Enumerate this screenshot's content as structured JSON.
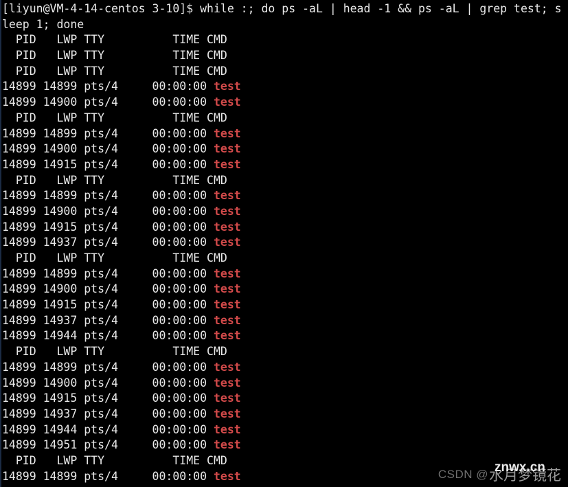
{
  "terminal": {
    "background_color": "#000000",
    "foreground_color": "#e8e8e8",
    "accent_red": "#d24a4a",
    "prompt": "[liyun@VM-4-14-centos 3-10]$ ",
    "command": "while :; do ps -aL | head -1 && ps -aL | grep test; sleep 1; done",
    "header_text": "  PID   LWP TTY          TIME CMD",
    "lines": [
      {
        "type": "command",
        "text": "[liyun@VM-4-14-centos 3-10]$ while :; do ps -aL | head -1 && ps -aL | grep test; s"
      },
      {
        "type": "command",
        "text": "leep 1; done"
      },
      {
        "type": "header",
        "text": "  PID   LWP TTY          TIME CMD"
      },
      {
        "type": "header",
        "text": "  PID   LWP TTY          TIME CMD"
      },
      {
        "type": "header",
        "text": "  PID   LWP TTY          TIME CMD"
      },
      {
        "type": "process",
        "pid": "14899",
        "lwp": "14899",
        "tty": "pts/4",
        "time": "00:00:00",
        "cmd": "test"
      },
      {
        "type": "process",
        "pid": "14899",
        "lwp": "14900",
        "tty": "pts/4",
        "time": "00:00:00",
        "cmd": "test"
      },
      {
        "type": "header",
        "text": "  PID   LWP TTY          TIME CMD"
      },
      {
        "type": "process",
        "pid": "14899",
        "lwp": "14899",
        "tty": "pts/4",
        "time": "00:00:00",
        "cmd": "test"
      },
      {
        "type": "process",
        "pid": "14899",
        "lwp": "14900",
        "tty": "pts/4",
        "time": "00:00:00",
        "cmd": "test"
      },
      {
        "type": "process",
        "pid": "14899",
        "lwp": "14915",
        "tty": "pts/4",
        "time": "00:00:00",
        "cmd": "test"
      },
      {
        "type": "header",
        "text": "  PID   LWP TTY          TIME CMD"
      },
      {
        "type": "process",
        "pid": "14899",
        "lwp": "14899",
        "tty": "pts/4",
        "time": "00:00:00",
        "cmd": "test"
      },
      {
        "type": "process",
        "pid": "14899",
        "lwp": "14900",
        "tty": "pts/4",
        "time": "00:00:00",
        "cmd": "test"
      },
      {
        "type": "process",
        "pid": "14899",
        "lwp": "14915",
        "tty": "pts/4",
        "time": "00:00:00",
        "cmd": "test"
      },
      {
        "type": "process",
        "pid": "14899",
        "lwp": "14937",
        "tty": "pts/4",
        "time": "00:00:00",
        "cmd": "test"
      },
      {
        "type": "header",
        "text": "  PID   LWP TTY          TIME CMD"
      },
      {
        "type": "process",
        "pid": "14899",
        "lwp": "14899",
        "tty": "pts/4",
        "time": "00:00:00",
        "cmd": "test"
      },
      {
        "type": "process",
        "pid": "14899",
        "lwp": "14900",
        "tty": "pts/4",
        "time": "00:00:00",
        "cmd": "test"
      },
      {
        "type": "process",
        "pid": "14899",
        "lwp": "14915",
        "tty": "pts/4",
        "time": "00:00:00",
        "cmd": "test"
      },
      {
        "type": "process",
        "pid": "14899",
        "lwp": "14937",
        "tty": "pts/4",
        "time": "00:00:00",
        "cmd": "test"
      },
      {
        "type": "process",
        "pid": "14899",
        "lwp": "14944",
        "tty": "pts/4",
        "time": "00:00:00",
        "cmd": "test"
      },
      {
        "type": "header",
        "text": "  PID   LWP TTY          TIME CMD"
      },
      {
        "type": "process",
        "pid": "14899",
        "lwp": "14899",
        "tty": "pts/4",
        "time": "00:00:00",
        "cmd": "test"
      },
      {
        "type": "process",
        "pid": "14899",
        "lwp": "14900",
        "tty": "pts/4",
        "time": "00:00:00",
        "cmd": "test"
      },
      {
        "type": "process",
        "pid": "14899",
        "lwp": "14915",
        "tty": "pts/4",
        "time": "00:00:00",
        "cmd": "test"
      },
      {
        "type": "process",
        "pid": "14899",
        "lwp": "14937",
        "tty": "pts/4",
        "time": "00:00:00",
        "cmd": "test"
      },
      {
        "type": "process",
        "pid": "14899",
        "lwp": "14944",
        "tty": "pts/4",
        "time": "00:00:00",
        "cmd": "test"
      },
      {
        "type": "process",
        "pid": "14899",
        "lwp": "14951",
        "tty": "pts/4",
        "time": "00:00:00",
        "cmd": "test"
      },
      {
        "type": "header",
        "text": "  PID   LWP TTY          TIME CMD"
      },
      {
        "type": "process",
        "pid": "14899",
        "lwp": "14899",
        "tty": "pts/4",
        "time": "00:00:00",
        "cmd": "test"
      }
    ]
  },
  "watermark": {
    "prefix": "CSDN @",
    "author": "水月梦镜花",
    "overlay": "znwx.cn"
  }
}
